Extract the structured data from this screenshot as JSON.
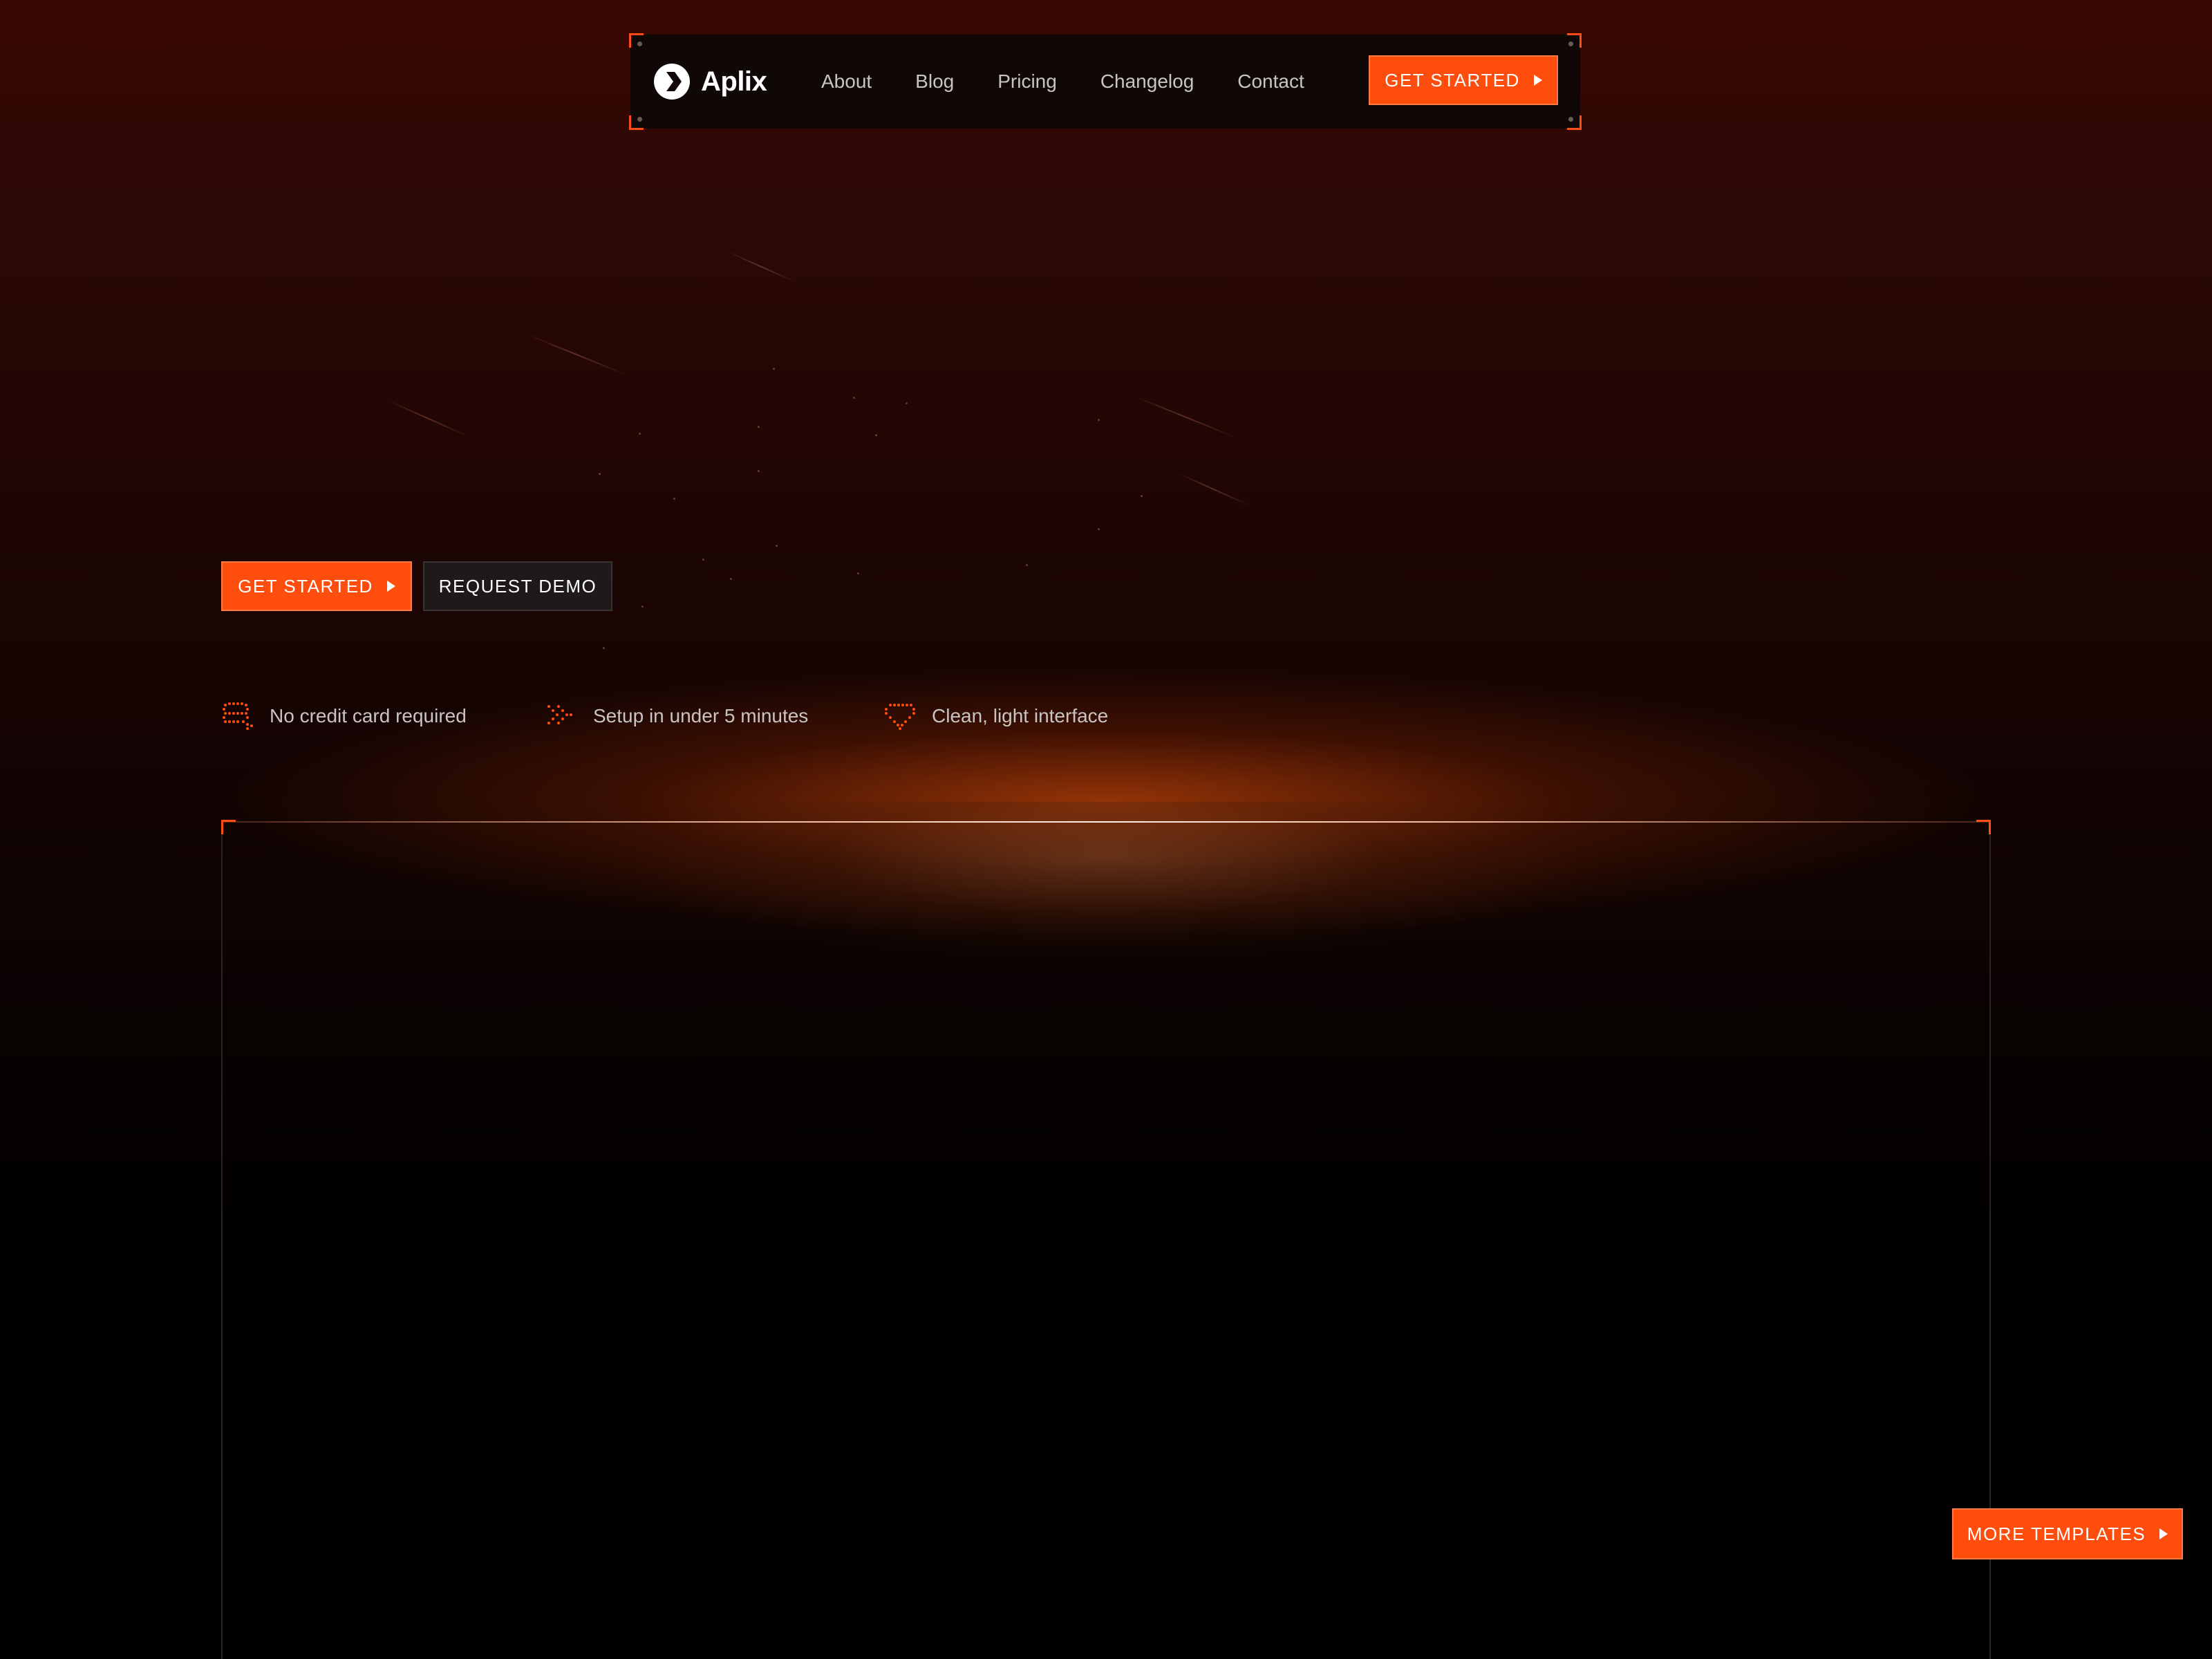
{
  "brand": {
    "name": "Aplix",
    "accent_color": "#ff4d0d"
  },
  "nav": {
    "links": [
      "About",
      "Blog",
      "Pricing",
      "Changelog",
      "Contact"
    ],
    "cta_label": "GET STARTED"
  },
  "hero": {
    "primary_label": "GET STARTED",
    "secondary_label": "REQUEST DEMO"
  },
  "features": [
    {
      "icon": "credit-card-icon",
      "label": "No credit card required"
    },
    {
      "icon": "fast-forward-icon",
      "label": "Setup in under 5 minutes"
    },
    {
      "icon": "diamond-icon",
      "label": "Clean, light interface"
    }
  ],
  "floating": {
    "more_templates_label": "MORE TEMPLATES"
  }
}
